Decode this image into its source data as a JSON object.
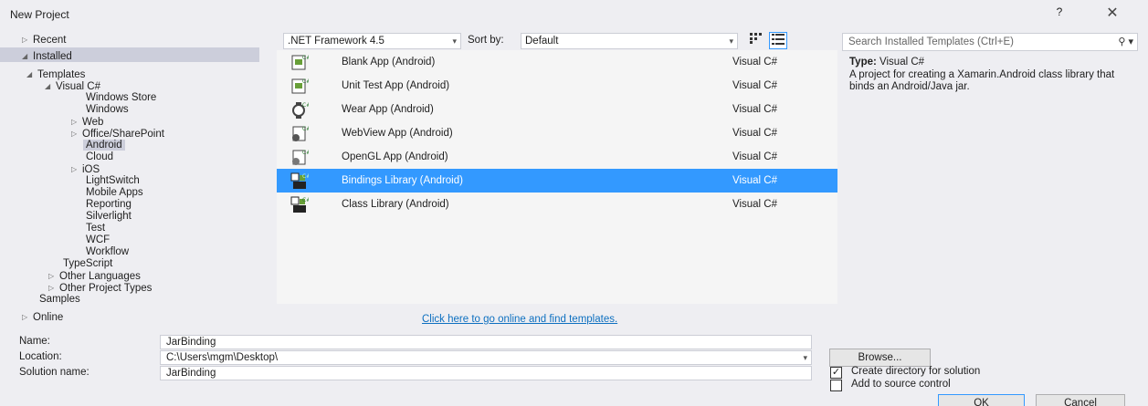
{
  "dialog": {
    "title": "New Project",
    "help": "?",
    "close": "✕"
  },
  "tree": {
    "recent": "Recent",
    "installed": "Installed",
    "templates": "Templates",
    "visual_csharp": "Visual C#",
    "items": [
      "Windows Store",
      "Windows",
      "Web",
      "Office/SharePoint",
      "Android",
      "Cloud",
      "iOS",
      "LightSwitch",
      "Mobile Apps",
      "Reporting",
      "Silverlight",
      "Test",
      "WCF",
      "Workflow"
    ],
    "typescript": "TypeScript",
    "other_languages": "Other Languages",
    "other_project_types": "Other Project Types",
    "samples": "Samples",
    "online": "Online"
  },
  "toolbar": {
    "framework": ".NET Framework 4.5",
    "sort_label": "Sort by:",
    "sort_value": "Default"
  },
  "templates": [
    {
      "name": "Blank App (Android)",
      "lang": "Visual C#"
    },
    {
      "name": "Unit Test App (Android)",
      "lang": "Visual C#"
    },
    {
      "name": "Wear App (Android)",
      "lang": "Visual C#"
    },
    {
      "name": "WebView App (Android)",
      "lang": "Visual C#"
    },
    {
      "name": "OpenGL App (Android)",
      "lang": "Visual C#"
    },
    {
      "name": "Bindings Library (Android)",
      "lang": "Visual C#"
    },
    {
      "name": "Class Library (Android)",
      "lang": "Visual C#"
    }
  ],
  "online_link": "Click here to go online and find templates.",
  "search": {
    "placeholder": "Search Installed Templates (Ctrl+E)"
  },
  "info": {
    "type_label": "Type:",
    "type_value": "Visual C#",
    "description": "A project for creating a Xamarin.Android class library that binds an Android/Java jar."
  },
  "form": {
    "name_label": "Name:",
    "name_value": "JarBinding",
    "location_label": "Location:",
    "location_value": "C:\\Users\\mgm\\Desktop\\",
    "solution_label": "Solution name:",
    "solution_value": "JarBinding",
    "browse": "Browse...",
    "create_dir_label": "Create directory for solution",
    "create_dir_checked": true,
    "source_control_label": "Add to source control",
    "source_control_checked": false,
    "ok": "OK",
    "cancel": "Cancel"
  },
  "colors": {
    "selection": "#3399ff",
    "link": "#0e70c0",
    "tree_selection": "#cccedb"
  },
  "icons": {
    "template": "android-project-icon",
    "search": "search-icon",
    "list_view": "list-view-icon",
    "grid_view": "small-icons-view-icon"
  }
}
